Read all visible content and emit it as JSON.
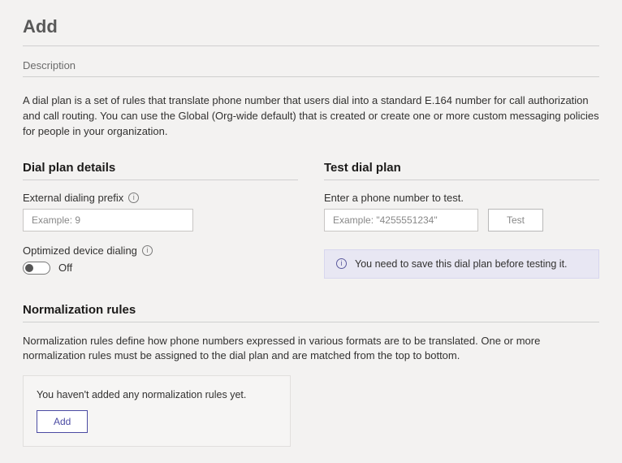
{
  "page": {
    "title": "Add",
    "description_placeholder": "Description",
    "intro": "A dial plan is a set of rules that translate phone number that users dial into a standard E.164 number for call authorization and call routing. You can use the Global (Org-wide default) that is created or create one or more custom messaging policies for people in your organization."
  },
  "details": {
    "heading": "Dial plan details",
    "external_prefix_label": "External dialing prefix",
    "external_prefix_placeholder": "Example: 9",
    "optimized_label": "Optimized device dialing",
    "optimized_state": "Off"
  },
  "test": {
    "heading": "Test dial plan",
    "subheading": "Enter a phone number to test.",
    "input_placeholder": "Example: \"4255551234\"",
    "button": "Test",
    "notice": "You need to save this dial plan before testing it."
  },
  "norm": {
    "heading": "Normalization rules",
    "description": "Normalization rules define how phone numbers expressed in various formats are to be translated. One or more normalization rules must be assigned to the dial plan and are matched from the top to bottom.",
    "empty_text": "You haven't added any normalization rules yet.",
    "add_button": "Add"
  }
}
